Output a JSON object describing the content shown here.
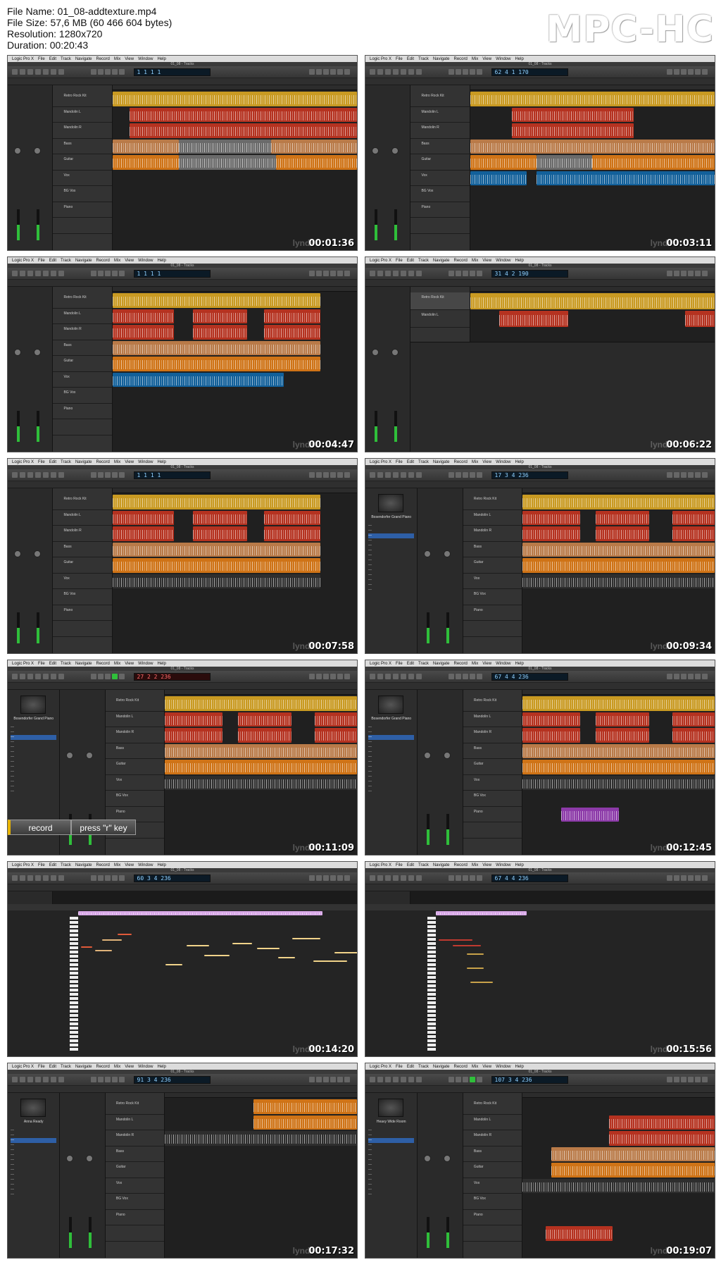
{
  "file_info": {
    "name": "File Name: 01_08-addtexture.mp4",
    "size": "File Size: 57,6 MB (60 466 604 bytes)",
    "resolution": "Resolution: 1280x720",
    "duration": "Duration: 00:20:43"
  },
  "brand": "MPC-HC",
  "menu": [
    "Logic Pro X",
    "File",
    "Edit",
    "Track",
    "Navigate",
    "Record",
    "Mix",
    "View",
    "Window",
    "Help"
  ],
  "window_title": "01_08 - Tracks",
  "lcd_values": [
    "1 1 1 1",
    "62 4 1 170",
    "1 1 1 1",
    "31 4 2 190",
    "1 1 1 1",
    "17 3 4 236",
    "27 2 2 236",
    "67 4 4 236",
    "60 3 4 236",
    "67 4 4 236",
    "91 3 4 236",
    "107 3 4 236"
  ],
  "timestamps": [
    "00:01:36",
    "00:03:11",
    "00:04:47",
    "00:06:22",
    "00:07:58",
    "00:09:34",
    "00:11:09",
    "00:12:45",
    "00:14:20",
    "00:15:56",
    "00:17:32",
    "00:19:07"
  ],
  "watermark": "lynda",
  "overlay": {
    "first": "record",
    "second": "press \"r\" key"
  },
  "library_names": {
    "piano": "Bosendorfer Grand Piano",
    "drums": "Anna Ready",
    "room": "Heavy Wide Room"
  },
  "track_names": [
    "Retro Rock Kit",
    "Mandolin L",
    "Mandolin R",
    "Bass",
    "Guitar",
    "Vox",
    "BG Vox",
    "Piano"
  ],
  "colors": {
    "gold": "#c99a22",
    "red": "#b53220",
    "tan": "#b97a48",
    "orange": "#cf7316",
    "blue": "#12609a",
    "purple": "#8c3aa8"
  }
}
